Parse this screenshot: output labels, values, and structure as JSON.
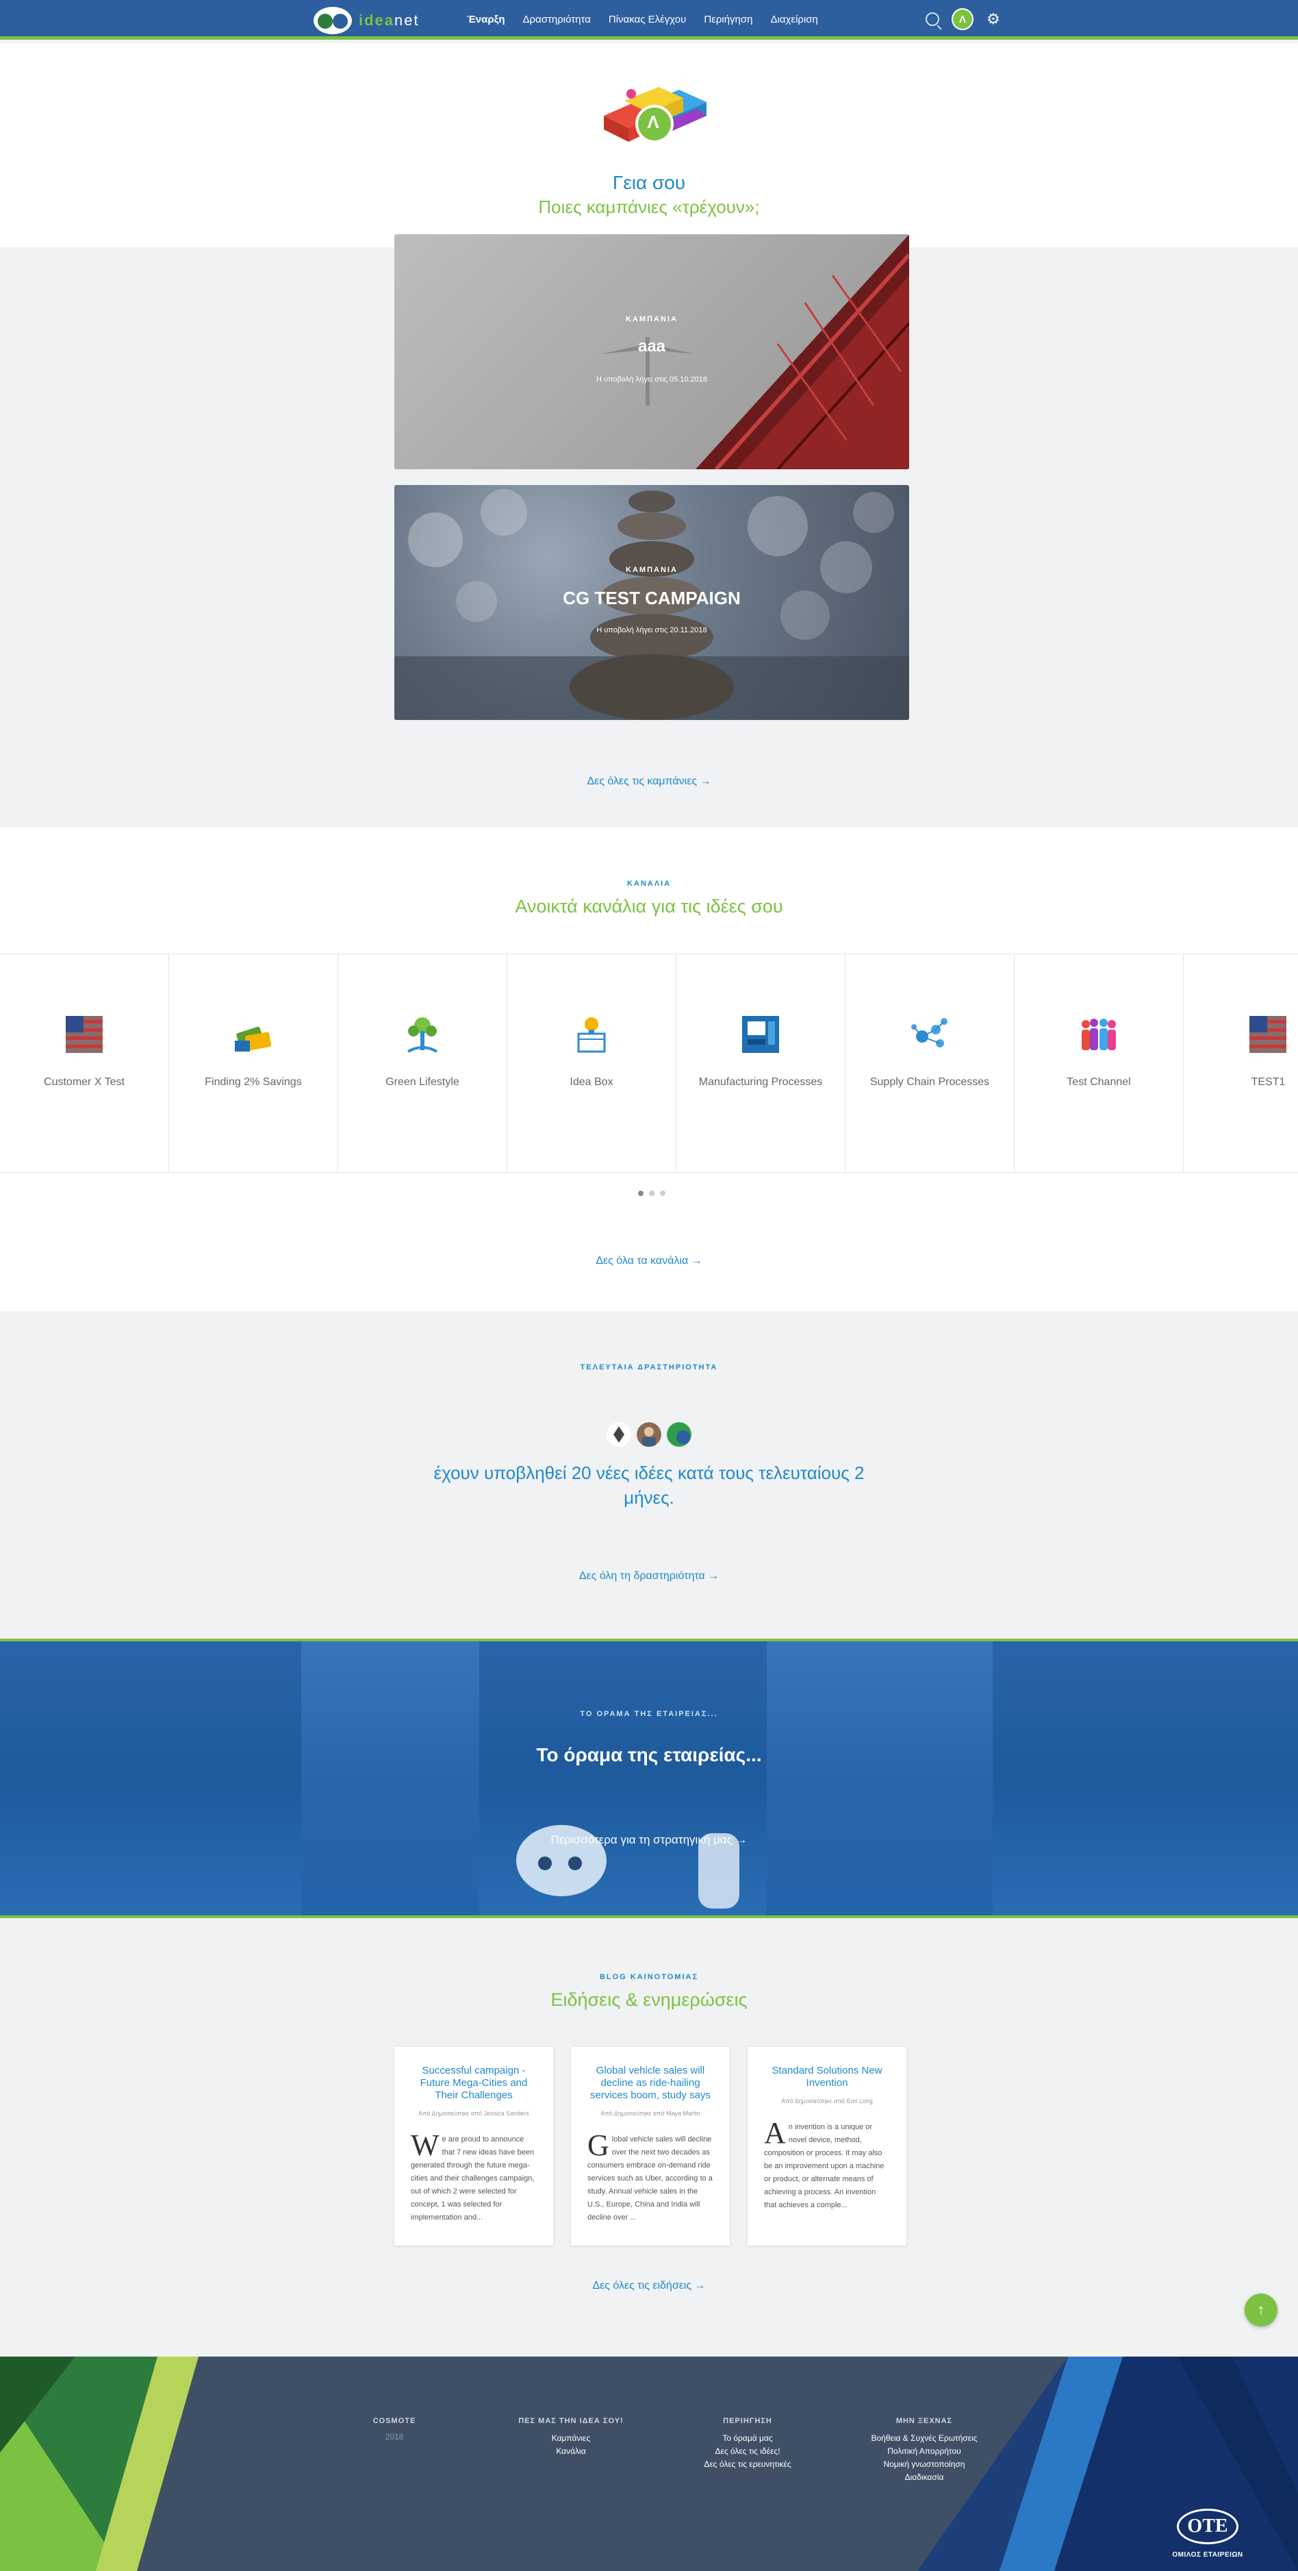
{
  "nav": {
    "logo_prefix": "idea",
    "logo_suffix": "net",
    "menu": [
      "Έναρξη",
      "Δραστηριότητα",
      "Πίνακας Ελέγχου",
      "Περιήγηση",
      "Διαχείριση"
    ],
    "avatar_initial": "Λ"
  },
  "hero": {
    "avatar_initial": "Λ",
    "hello": "Γεια σου",
    "subtitle": "Ποιες καμπάνιες «τρέχουν»;"
  },
  "campaigns": [
    {
      "label": "ΚΑΜΠΑΝΙΑ",
      "title": "aaa",
      "deadline": "Η υποβολή λήγει στις 05.10.2018"
    },
    {
      "label": "ΚΑΜΠΑΝΙΑ",
      "title": "CG TEST CAMPAIGN",
      "deadline": "Η υποβολή λήγει στις 20.11.2018"
    }
  ],
  "campaigns_link": "Δες όλες τις καμπάνιες →",
  "channels": {
    "label": "ΚΑΝΑΛΙΑ",
    "title": "Ανοικτά κανάλια για τις ιδέες σου",
    "items": [
      {
        "name": "Customer X Test",
        "icon": "flag-icon"
      },
      {
        "name": "Finding 2% Savings",
        "icon": "money-icon"
      },
      {
        "name": "Green Lifestyle",
        "icon": "tree-icon"
      },
      {
        "name": "Idea Box",
        "icon": "bulb-box-icon"
      },
      {
        "name": "Manufacturing Processes",
        "icon": "machine-icon"
      },
      {
        "name": "Supply Chain Processes",
        "icon": "network-icon"
      },
      {
        "name": "Test Channel",
        "icon": "people-icon"
      },
      {
        "name": "TEST1",
        "icon": "flag-icon"
      }
    ],
    "link": "Δες όλα τα κανάλια →"
  },
  "activity": {
    "label": "ΤΕΛΕΥΤΑΙΑ ΔΡΑΣΤΗΡΙΟΤΗΤΑ",
    "text": "έχουν υποβληθεί 20 νέες ιδέες κατά τους τελευταίους 2 μήνες.",
    "link": "Δες όλη τη δραστηριότητα →"
  },
  "vision": {
    "label": "ΤΟ ΟΡΑΜΑ ΤΗΣ ΕΤΑΙΡΕΙΑΣ...",
    "title": "Το όραμα της εταιρείας...",
    "link": "Περισσότερα για τη στρατηγική μας →"
  },
  "blog": {
    "label": "BLOG ΚΑΙΝΟΤΟΜΙΑΣ",
    "title": "Ειδήσεις & ενημερώσεις",
    "posts": [
      {
        "title": "Successful campaign - Future Mega-Cities and Their Challenges",
        "author": "Από Δημοσιεύτηκε από Jessica Sanders",
        "initial": "W",
        "body": "e are proud to announce that 7 new ideas have been generated through the future mega-cities and their challenges campaign, out of which 2 were selected for concept, 1 was selected for implementation and..."
      },
      {
        "title": "Global vehicle sales will decline as ride-hailing services boom, study says",
        "author": "Από Δημοσιεύτηκε από Maya Martin",
        "initial": "G",
        "body": "lobal vehicle sales will decline over the next two decades as consumers embrace on-demand ride services such as Uber, according to a study. Annual vehicle sales in the U.S., Europe, China and India will decline over ..."
      },
      {
        "title": "Standard Solutions New Invention",
        "author": "Από Δημοσιεύτηκε από Emi Long",
        "initial": "A",
        "body": "n invention is a unique or novel device, method, composition or process. It may also be an improvement upon a machine or product, or alternate means of achieving a process. An invention that achieves a comple..."
      }
    ],
    "link": "Δες όλες τις ειδήσεις →"
  },
  "footer": {
    "col1": {
      "head": "COSMOTE",
      "year": "2018"
    },
    "col2": {
      "head": "ΠΕΣ ΜΑΣ ΤΗΝ ΙΔΕΑ ΣΟΥ!",
      "links": [
        "Καμπάνιες",
        "Κανάλια"
      ]
    },
    "col3": {
      "head": "ΠΕΡΙΗΓΗΣΗ",
      "links": [
        "Το όραμά μας",
        "Δες όλες τις ιδέες!",
        "Δες όλες τις ερευνητικές"
      ]
    },
    "col4": {
      "head": "ΜΗΝ ΞΕΧΝΑΣ",
      "links": [
        "Βοήθεια & Συχνές Ερωτήσεις",
        "Πολιτική Απορρήτου",
        "Νομική γνωστοποίηση",
        "Διαδικασία"
      ]
    },
    "brand": "ΟΤΕ",
    "brand_sub": "ΟΜΙΛΟΣ ΕΤΑΙΡΕΙΩΝ"
  },
  "colors": {
    "primary": "#2d5f9e",
    "accent_green": "#7cc242",
    "link_blue": "#1f89c9"
  }
}
